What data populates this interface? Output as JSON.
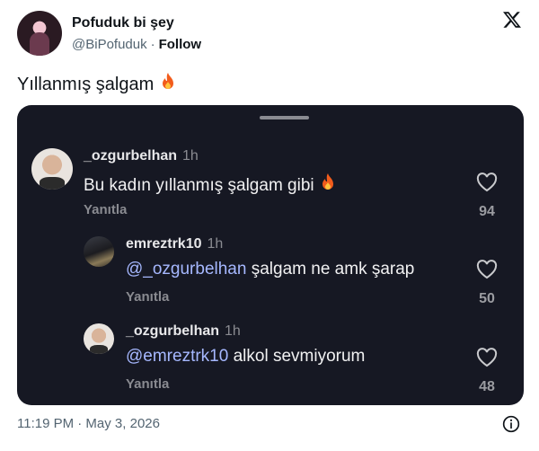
{
  "author": {
    "name": "Pofuduk bi şey",
    "handle": "@BiPofuduk",
    "separator": "·",
    "follow_label": "Follow"
  },
  "tweet": {
    "text": "Yıllanmış şalgam",
    "emoji": "fire-emoji",
    "timestamp": "11:19 PM · May 3, 2026"
  },
  "comments": [
    {
      "user": "_ozgurbelhan",
      "ago": "1h",
      "text": "Bu kadın yıllanmış şalgam gibi",
      "mention": "",
      "reply": "Yanıtla",
      "likes": "94",
      "has_fire": true
    },
    {
      "user": "emreztrk10",
      "ago": "1h",
      "mention": "@_ozgurbelhan",
      "text": "şalgam ne amk şarap",
      "reply": "Yanıtla",
      "likes": "50"
    },
    {
      "user": "_ozgurbelhan",
      "ago": "1h",
      "mention": "@emreztrk10",
      "text": "alkol sevmiyorum",
      "reply": "Yanıtla",
      "likes": "48"
    }
  ],
  "colors": {
    "card_bg": "#161823",
    "mention": "#a6b8ff",
    "muted": "#8a8b91"
  },
  "icons": [
    "x-logo-icon",
    "heart-icon",
    "info-icon",
    "fire-emoji"
  ]
}
